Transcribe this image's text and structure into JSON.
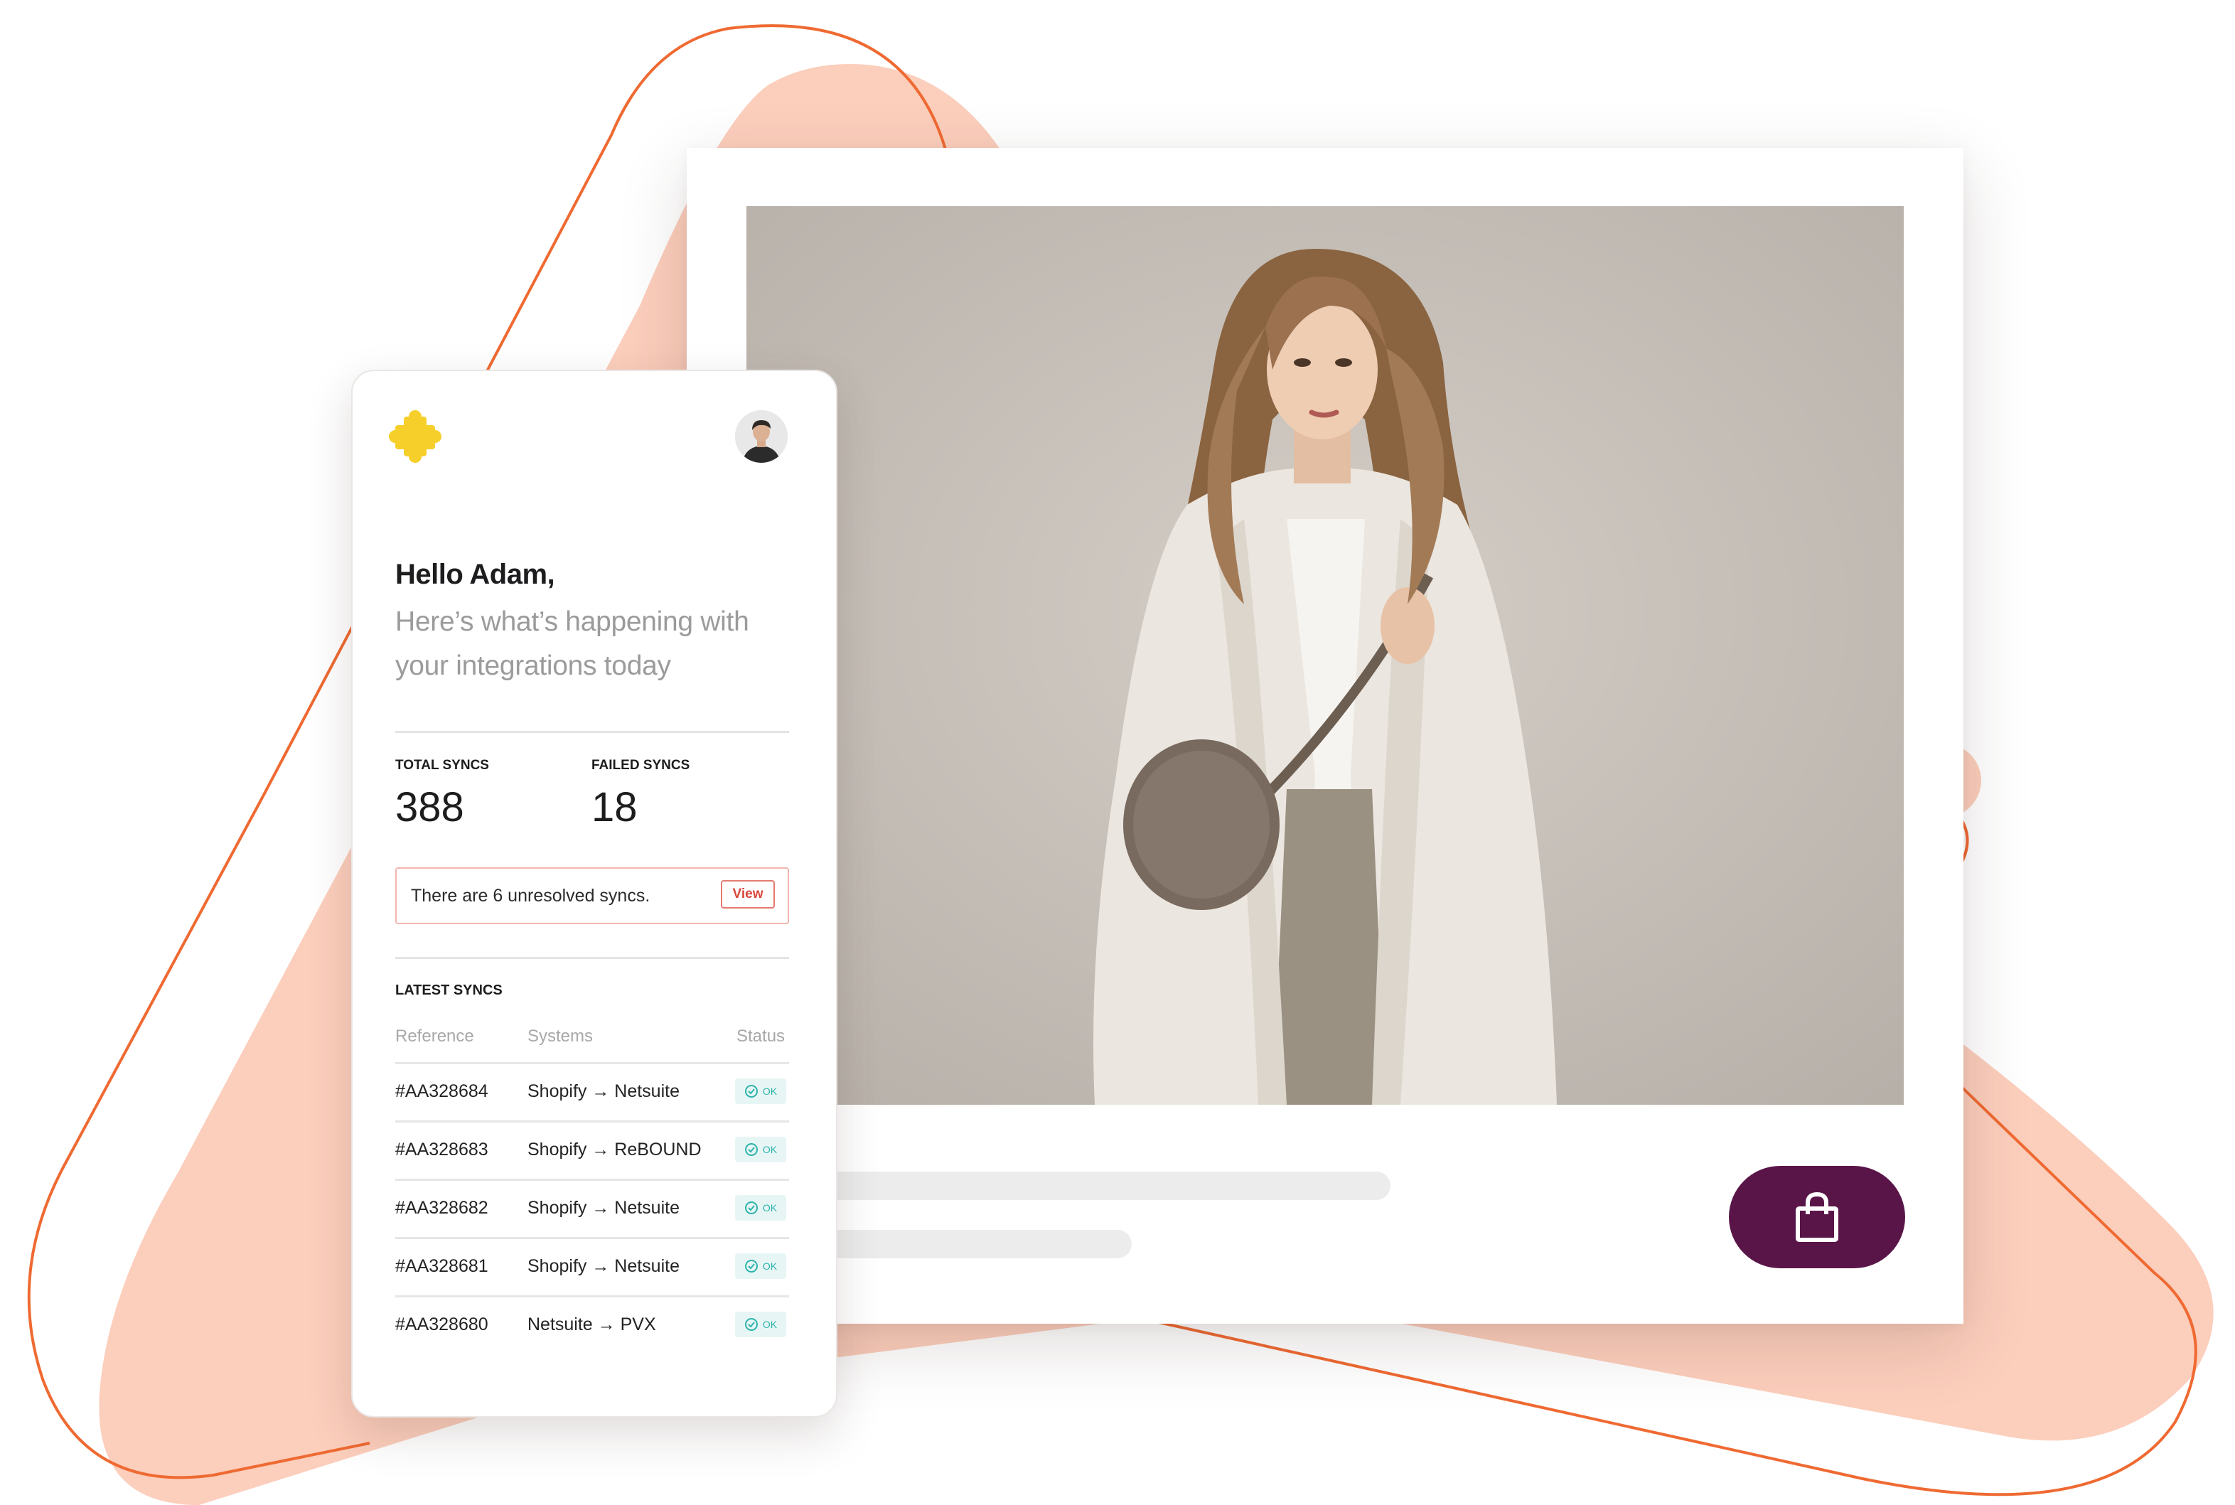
{
  "colors": {
    "brand_orange": "#ef6a32",
    "blob_peach": "#f9a585",
    "buy_button": "#5a1548",
    "logo_yellow": "#f7cf2b",
    "status_teal": "#2db3ac",
    "alert_red": "#d9473b"
  },
  "product": {
    "image_icon": "fashion-model-photo",
    "buy_icon": "shopping-bag-icon"
  },
  "dashboard": {
    "logo_icon": "puzzle-logo-icon",
    "avatar_icon": "user-avatar",
    "greeting": "Hello Adam,",
    "subtitle": "Here’s what’s happening with your integrations today",
    "stats": {
      "total_label": "TOTAL SYNCS",
      "total_value": "388",
      "failed_label": "FAILED SYNCS",
      "failed_value": "18"
    },
    "alert": {
      "text": "There are 6 unresolved syncs.",
      "button": "View"
    },
    "latest": {
      "title": "LATEST SYNCS",
      "columns": [
        "Reference",
        "Systems",
        "Status"
      ],
      "rows": [
        {
          "ref": "#AA328684",
          "systems": "Shopify → Netsuite",
          "status": "OK"
        },
        {
          "ref": "#AA328683",
          "systems": "Shopify → ReBOUND",
          "status": "OK"
        },
        {
          "ref": "#AA328682",
          "systems": "Shopify → Netsuite",
          "status": "OK"
        },
        {
          "ref": "#AA328681",
          "systems": "Shopify → Netsuite",
          "status": "OK"
        },
        {
          "ref": "#AA328680",
          "systems": "Netsuite → PVX",
          "status": "OK"
        }
      ]
    }
  }
}
